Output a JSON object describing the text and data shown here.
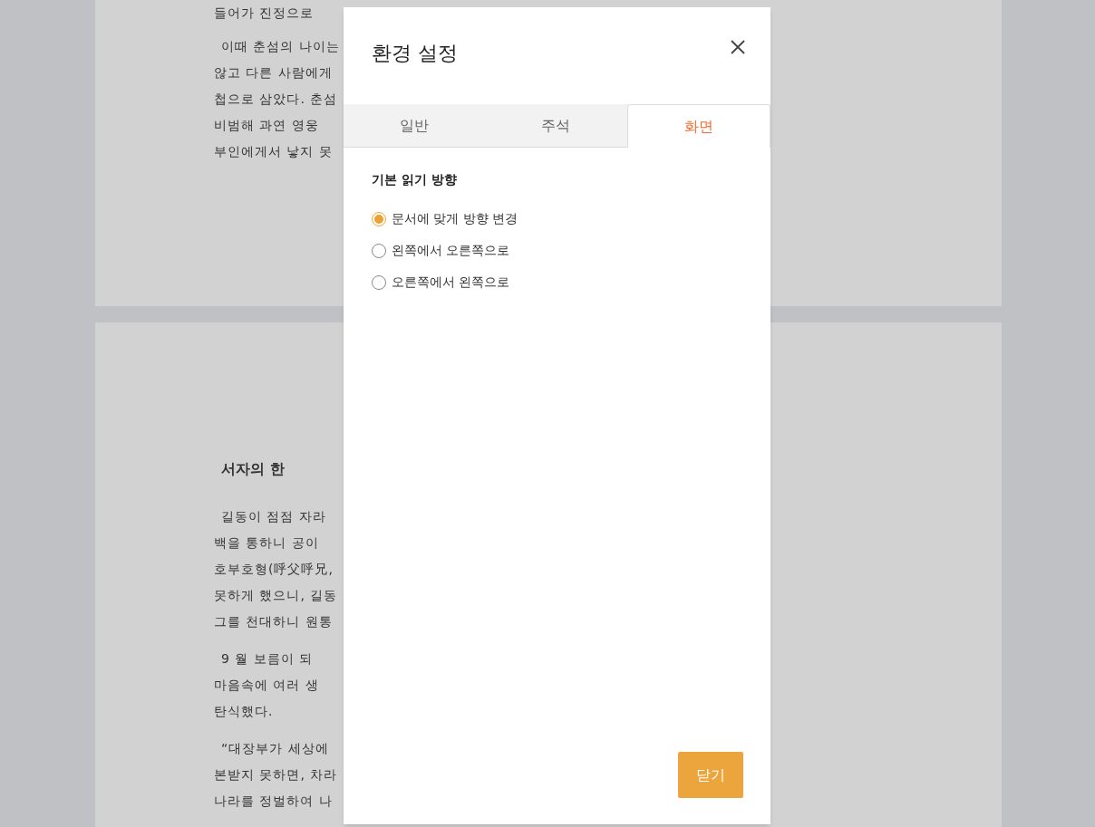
{
  "document": {
    "pages": [
      {
        "lines": [
          "들어가 진정으로",
          "이때 춘섬의 나이는",
          "않고 다른 사람에게",
          "첩으로 삼았다. 춘섬",
          "비범해 과연 영웅",
          "부인에게서 낳지 못"
        ]
      },
      {
        "heading": "서자의 한",
        "lines": [
          "길동이 점점 자라",
          "백을 통하니 공이",
          "호부호형(呼父呼兄,",
          "못하게 했으니, 길동",
          "그를 천대하니 원통",
          "9 월 보름이 되",
          "마음속에 여러 생",
          "탄식했다.",
          "“대장부가 세상에",
          "본받지 못하면, 차라",
          "나라를 정벌하여 나"
        ]
      }
    ]
  },
  "dialog": {
    "title": "환경 설정",
    "tabs": [
      {
        "label": "일반",
        "selected": false
      },
      {
        "label": "주석",
        "selected": false
      },
      {
        "label": "화면",
        "selected": true
      }
    ],
    "section_title": "기본 읽기 방향",
    "options": [
      {
        "label": "문서에 맞게 방향 변경",
        "selected": true
      },
      {
        "label": "왼쪽에서 오른쪽으로",
        "selected": false
      },
      {
        "label": "오른쪽에서 왼쪽으로",
        "selected": false
      }
    ],
    "close_button": "닫기"
  }
}
